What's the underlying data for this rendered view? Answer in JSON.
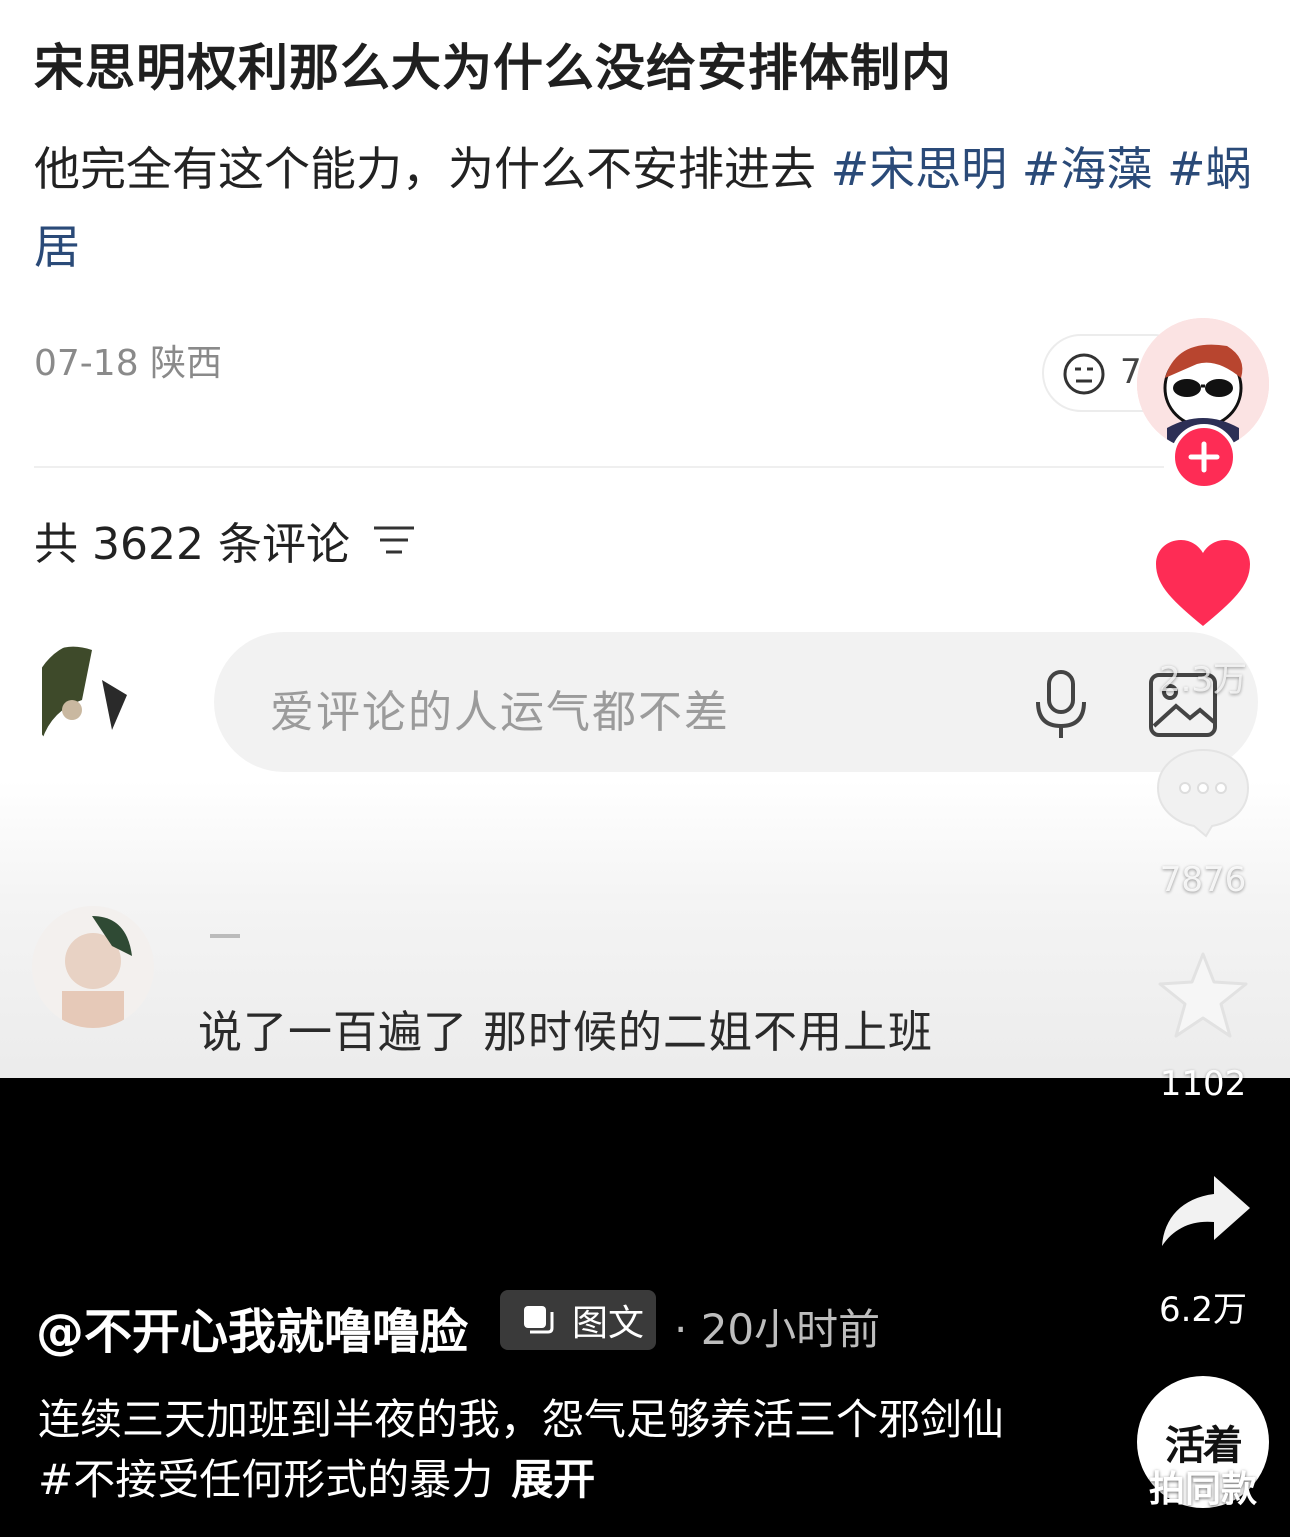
{
  "post": {
    "title": "宋思明权利那么大为什么没给安排体制内",
    "body_text": "他完全有这个能力，为什么不安排进去",
    "hashtags": [
      "#宋思明",
      "#海藻",
      "#蜗居"
    ],
    "date": "07-18",
    "location": "陕西",
    "reaction_count": "7"
  },
  "comments": {
    "count_label": "共 3622 条评论",
    "input_placeholder": "爱评论的人运气都不差",
    "first_comment_text": "说了一百遍了 那时候的二姐不用上班"
  },
  "rail": {
    "likes": "2.3万",
    "comments": "7876",
    "favorites": "1102",
    "shares": "6.2万",
    "music_label": "拍同款",
    "music_logo": "活着",
    "like_color": "#fe2c55"
  },
  "caption": {
    "author": "@不开心我就噜噜脸",
    "type_badge": "图文",
    "time": "· 20小时前",
    "text": "连续三天加班到半夜的我，怨气足够养活三个邪剑仙#不接受任何形式的暴力",
    "expand": "展开"
  }
}
